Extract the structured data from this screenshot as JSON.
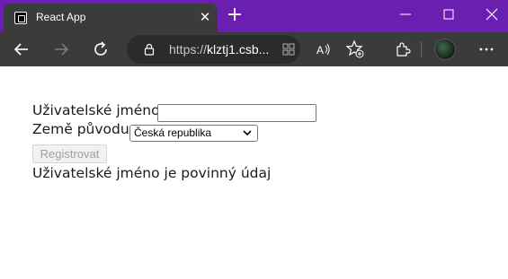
{
  "browser": {
    "tab_title": "React App",
    "tab_close_glyph": "✕",
    "new_tab_glyph": "+",
    "url_scheme": "https://",
    "url_host": "klztj1.csb...",
    "accent_color": "#6a1fb0"
  },
  "form": {
    "username_label": "Uživatelské jméno:",
    "username_value": "",
    "country_label": "Země původu:",
    "country_selected": "Česká republika",
    "register_label": "Registrovat",
    "error_message": "Uživatelské jméno je povinný údaj"
  }
}
